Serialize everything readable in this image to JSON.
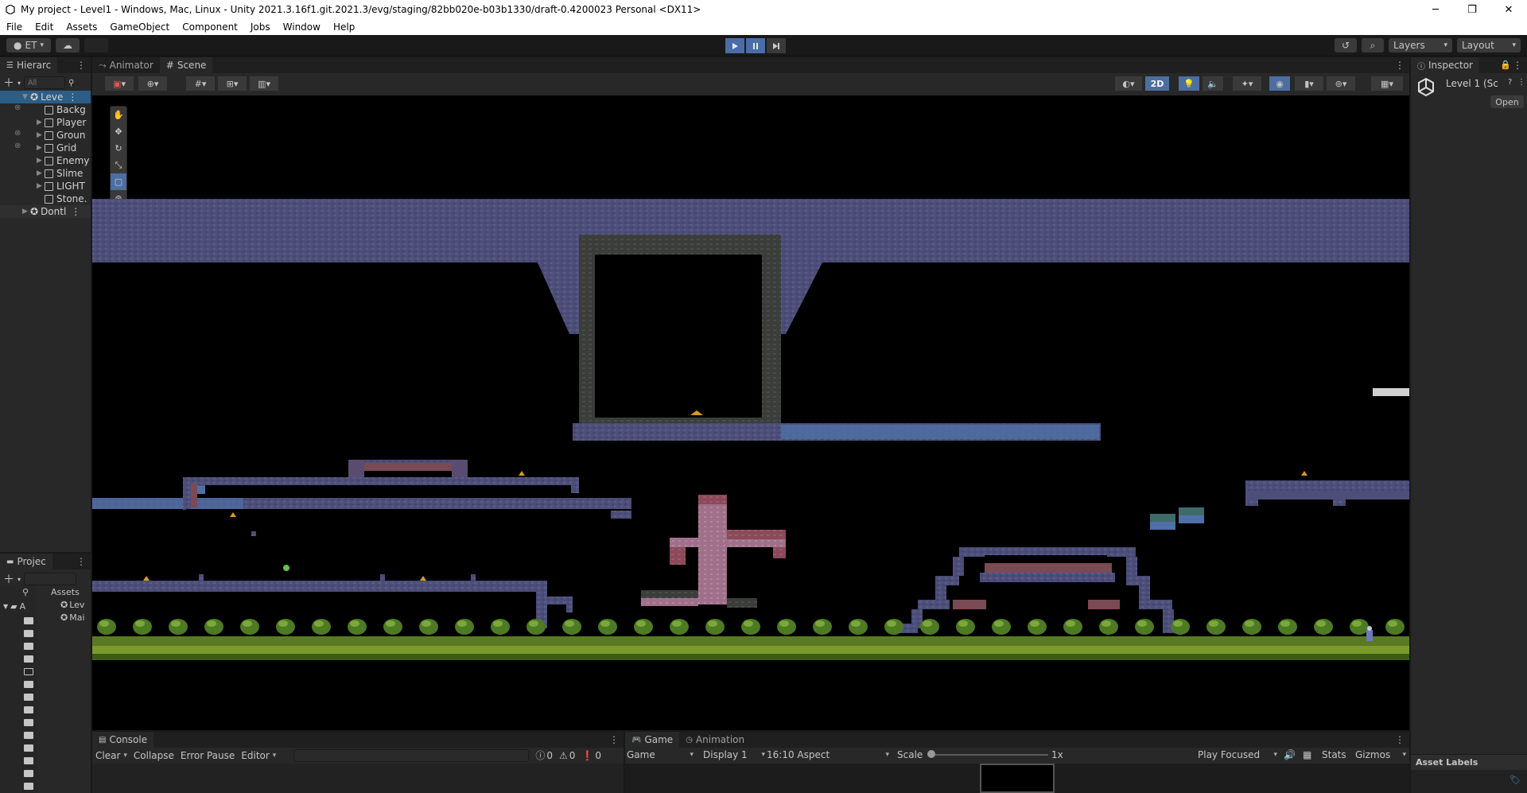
{
  "window": {
    "title": "My project - Level1 - Windows, Mac, Linux - Unity 2021.3.16f1.git.2021.3/evg/staging/82bb020e-b03b1330/draft-0.4200023 Personal <DX11>",
    "minimize": "─",
    "restore": "❐",
    "close": "✕"
  },
  "menu": [
    "File",
    "Edit",
    "Assets",
    "GameObject",
    "Component",
    "Jobs",
    "Window",
    "Help"
  ],
  "toolbar": {
    "account": "ET",
    "layers": "Layers",
    "layout": "Layout"
  },
  "hierarchy": {
    "tab": "Hierarc",
    "search_placeholder": "All",
    "items": [
      {
        "label": "Leve",
        "depth": 0,
        "expanded": true,
        "selected": true,
        "scene": true
      },
      {
        "label": "Backg",
        "depth": 1,
        "expanded": false
      },
      {
        "label": "Player",
        "depth": 1,
        "expanded": false
      },
      {
        "label": "Groun",
        "depth": 1,
        "expanded": false
      },
      {
        "label": "Grid",
        "depth": 1,
        "expanded": false
      },
      {
        "label": "Enemy",
        "depth": 1,
        "expanded": false
      },
      {
        "label": "Slime",
        "depth": 1,
        "expanded": false
      },
      {
        "label": "LIGHT",
        "depth": 1,
        "expanded": false
      },
      {
        "label": "Stone.",
        "depth": 1,
        "expanded": false
      },
      {
        "label": "Dontl",
        "depth": 0,
        "expanded": false,
        "scene": true
      }
    ]
  },
  "scene_tabs": {
    "animator": "Animator",
    "scene": "Scene"
  },
  "scene_view": {
    "mode_2d": "2D"
  },
  "inspector": {
    "tab": "Inspector",
    "object_name": "Level 1 (Sc",
    "open_button": "Open",
    "asset_labels": "Asset Labels"
  },
  "project": {
    "tab": "Projec",
    "breadcrumb": "Assets",
    "tree_root": "A",
    "items": [
      "Lev",
      "Mai"
    ]
  },
  "console": {
    "tab": "Console",
    "clear": "Clear",
    "collapse": "Collapse",
    "error_pause": "Error Pause",
    "editor": "Editor",
    "count_logs": "0",
    "count_warnings": "0",
    "count_errors": "0"
  },
  "game": {
    "tab": "Game",
    "animation_tab": "Animation",
    "view_mode": "Game",
    "display": "Display 1",
    "aspect": "16:10 Aspect",
    "scale_label": "Scale",
    "scale_value": "1x",
    "play_focused": "Play Focused",
    "stats": "Stats",
    "gizmos": "Gizmos"
  },
  "colors": {
    "accent": "#4a6da8",
    "selection": "#2c5d87",
    "stone": "#4d4f7a",
    "grass": "#7a9a2e",
    "dark_stone": "#3b3b3b",
    "brick": "#8a4a5a"
  }
}
